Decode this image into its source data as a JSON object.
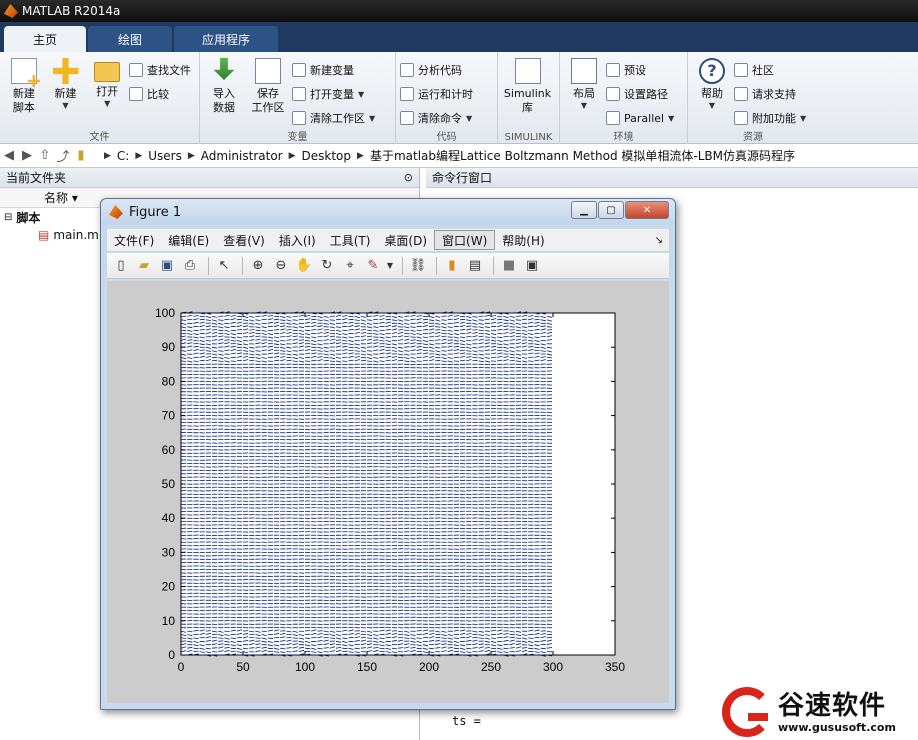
{
  "window": {
    "title": "MATLAB R2014a"
  },
  "tabs": [
    {
      "label": "主页",
      "active": true
    },
    {
      "label": "绘图",
      "active": false
    },
    {
      "label": "应用程序",
      "active": false
    }
  ],
  "ribbon": {
    "file": {
      "label": "文件",
      "new_script": "新建\n脚本",
      "new": "新建",
      "open": "打开",
      "find_files": "查找文件",
      "compare": "比较"
    },
    "variable": {
      "label": "变量",
      "import": "导入\n数据",
      "save_ws": "保存\n工作区",
      "new_var": "新建变量",
      "open_var": "打开变量",
      "clear_ws": "清除工作区"
    },
    "code": {
      "label": "代码",
      "analyze": "分析代码",
      "run_time": "运行和计时",
      "clear_cmd": "清除命令"
    },
    "simulink": {
      "label": "SIMULINK",
      "lib": "Simulink\n库"
    },
    "environment": {
      "label": "环境",
      "layout": "布局",
      "prefs": "预设",
      "set_path": "设置路径",
      "parallel": "Parallel"
    },
    "resources": {
      "label": "资源",
      "help": "帮助",
      "community": "社区",
      "support": "请求支持",
      "addons": "附加功能"
    }
  },
  "address": {
    "crumbs": [
      "C:",
      "Users",
      "Administrator",
      "Desktop",
      "基于matlab编程Lattice Boltzmann Method 模拟单相流体-LBM仿真源码程序"
    ]
  },
  "left_pane": {
    "title": "当前文件夹",
    "col_name": "名称 ▾",
    "tree_group": "脚本",
    "file": "main.m"
  },
  "right_pane": {
    "title": "命令行窗口",
    "text": "ts ="
  },
  "figure": {
    "title": "Figure 1",
    "menus": [
      "文件(F)",
      "编辑(E)",
      "查看(V)",
      "插入(I)",
      "工具(T)",
      "桌面(D)",
      "窗口(W)",
      "帮助(H)"
    ],
    "active_menu": "窗口(W)"
  },
  "chart_data": {
    "type": "quiver",
    "title": "",
    "xlabel": "",
    "ylabel": "",
    "xlim": [
      0,
      350
    ],
    "ylim": [
      0,
      100
    ],
    "xticks": [
      0,
      50,
      100,
      150,
      200,
      250,
      300,
      350
    ],
    "yticks": [
      0,
      10,
      20,
      30,
      40,
      50,
      60,
      70,
      80,
      90,
      100
    ],
    "field_x_range": [
      0,
      300
    ],
    "field_y_range": [
      0,
      100
    ],
    "grid": false,
    "color": "#001a80"
  },
  "watermark": {
    "cn": "谷速软件",
    "url": "www.gususoft.com"
  }
}
